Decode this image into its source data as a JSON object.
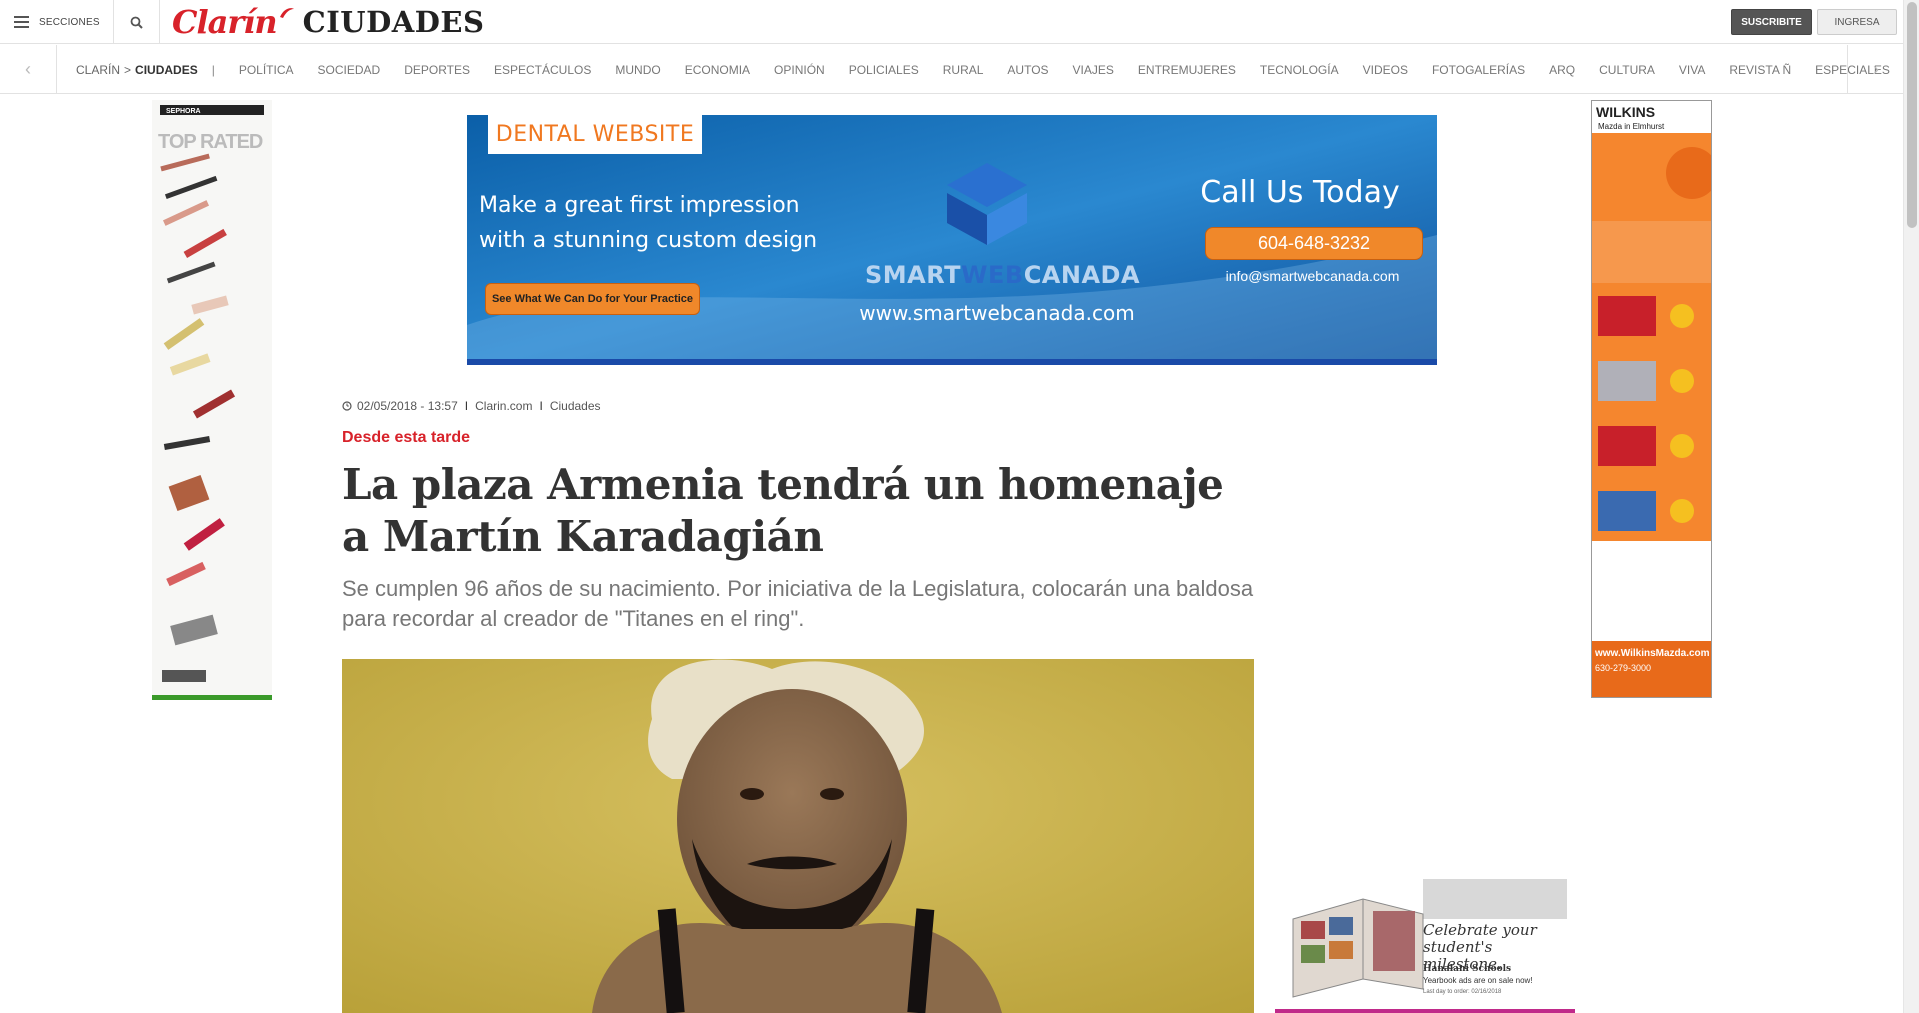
{
  "header": {
    "secciones_label": "SECCIONES",
    "logo_word": "Clarín",
    "section_title": "CIUDADES",
    "subscribe_label": "SUSCRIBITE",
    "login_label": "INGRESA"
  },
  "nav": {
    "crumb_root": "CLARÍN",
    "crumb_sep": ">",
    "crumb_current": "CIUDADES",
    "crumb_bar": "|",
    "items": [
      "POLÍTICA",
      "SOCIEDAD",
      "DEPORTES",
      "ESPECTÁCULOS",
      "MUNDO",
      "ECONOMIA",
      "OPINIÓN",
      "POLICIALES",
      "RURAL",
      "AUTOS",
      "VIAJES",
      "ENTREMUJERES",
      "TECNOLOGÍA",
      "VIDEOS",
      "FOTOGALERÍAS",
      "ARQ",
      "CULTURA",
      "VIVA",
      "REVISTA Ñ",
      "ESPECIALES"
    ]
  },
  "banner": {
    "tag": "DENTAL WEBSITE",
    "headline_line1": "Make a great first impression",
    "headline_line2": "with a stunning custom design",
    "cta": "See What We Can Do for Your Practice",
    "brand_a": "SMART",
    "brand_b": "WEB",
    "brand_c": "CANADA",
    "url": "www.smartwebcanada.com",
    "call": "Call Us Today",
    "phone": "604-648-3232",
    "email": "info@smartwebcanada.com"
  },
  "ad_left": {
    "brand": "SEPHORA",
    "headline": "TOP RATED"
  },
  "ad_right": {
    "brand": "WILKINS",
    "sub": "Mazda in Elmhurst",
    "footer_url": "www.WilkinsMazda.com",
    "footer_phone": "630-279-3000"
  },
  "article": {
    "date": "02/05/2018 - 13:57",
    "sep": "I",
    "source": "Clarin.com",
    "section": "Ciudades",
    "kicker": "Desde esta tarde",
    "title": "La plaza Armenia tendrá un homenaje a Martín Karadagián",
    "deck": "Se cumplen 96 años de su nacimiento. Por iniciativa de la Legislatura, colocarán una baldosa para recordar al creador de \"Titanes en el ring\"."
  },
  "ad_square": {
    "headline": "Celebrate your student's milestone.",
    "school": "Hanalani Schools",
    "sub": "Yearbook ads are on sale now!",
    "date": "Last day to order: 02/16/2018"
  },
  "colors": {
    "brand_red": "#d8222a",
    "banner_blue": "#1c6fc0",
    "cta_orange": "#f0882a"
  }
}
